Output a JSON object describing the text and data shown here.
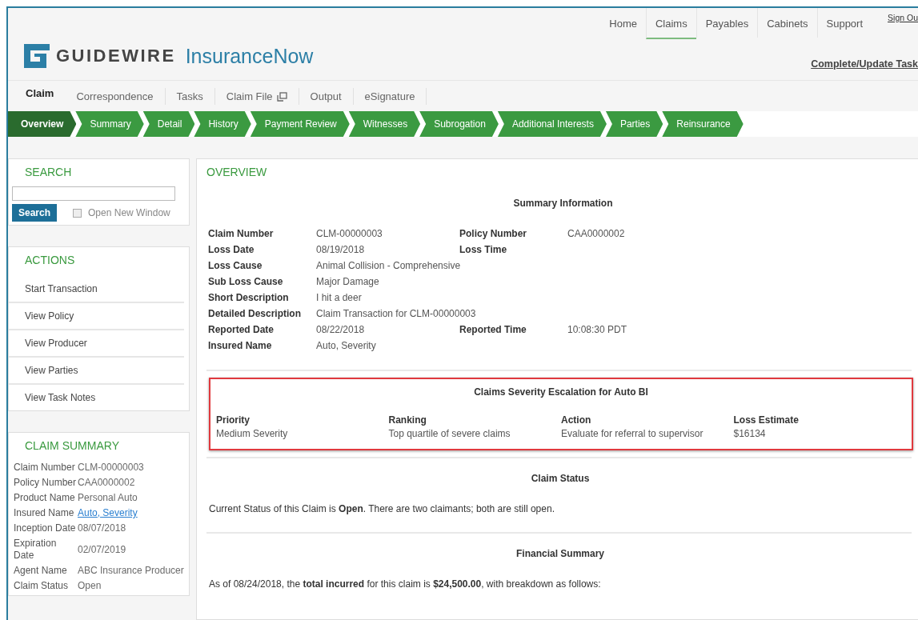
{
  "top_nav": [
    {
      "label": "Home",
      "selected": false
    },
    {
      "label": "Claims",
      "selected": true
    },
    {
      "label": "Payables",
      "selected": false
    },
    {
      "label": "Cabinets",
      "selected": false
    },
    {
      "label": "Support",
      "selected": false
    }
  ],
  "sign_out": "Sign Ou",
  "logo": {
    "brand": "GUIDEWIRE",
    "product": "InsuranceNow"
  },
  "task_link": "Complete/Update Task",
  "tabs": [
    {
      "label": "Claim",
      "selected": true,
      "kind": "plain"
    },
    {
      "label": "Correspondence",
      "selected": false,
      "kind": "plain"
    },
    {
      "label": "Tasks",
      "selected": false,
      "kind": "plain"
    },
    {
      "label": "Claim File",
      "selected": false,
      "kind": "popout"
    },
    {
      "label": "Output",
      "selected": false,
      "kind": "plain"
    },
    {
      "label": "eSignature",
      "selected": false,
      "kind": "plain"
    }
  ],
  "steps": [
    {
      "label": "Overview",
      "selected": true
    },
    {
      "label": "Summary",
      "selected": false
    },
    {
      "label": "Detail",
      "selected": false
    },
    {
      "label": "History",
      "selected": false
    },
    {
      "label": "Payment Review",
      "selected": false
    },
    {
      "label": "Witnesses",
      "selected": false
    },
    {
      "label": "Subrogation",
      "selected": false
    },
    {
      "label": "Additional Interests",
      "selected": false
    },
    {
      "label": "Parties",
      "selected": false
    },
    {
      "label": "Reinsurance",
      "selected": false
    }
  ],
  "search": {
    "title": "SEARCH",
    "button": "Search",
    "open_new_window": {
      "label": "Open New Window",
      "checked": false
    }
  },
  "actions": {
    "title": "ACTIONS",
    "items": [
      "Start Transaction",
      "View Policy",
      "View Producer",
      "View Parties",
      "View Task Notes"
    ]
  },
  "claim_summary": {
    "title": "CLAIM SUMMARY",
    "rows": [
      {
        "label": "Claim Number",
        "value": "CLM-00000003",
        "kind": "text"
      },
      {
        "label": "Policy Number",
        "value": "CAA0000002",
        "kind": "text"
      },
      {
        "label": "Product Name",
        "value": "Personal Auto",
        "kind": "text"
      },
      {
        "label": "Insured Name",
        "value": "Auto, Severity",
        "kind": "link"
      },
      {
        "label": "Inception Date",
        "value": "08/07/2018",
        "kind": "text"
      },
      {
        "label": "Expiration Date",
        "value": "02/07/2019",
        "kind": "text"
      },
      {
        "label": "Agent Name",
        "value": "ABC Insurance Producer",
        "kind": "text"
      },
      {
        "label": "Claim Status",
        "value": "Open",
        "kind": "text"
      }
    ]
  },
  "overview": {
    "title": "OVERVIEW",
    "summary": {
      "title": "Summary Information",
      "rows": [
        {
          "label": "Claim Number",
          "value": "CLM-00000003",
          "label_2": "Policy Number",
          "value_2": "CAA0000002"
        },
        {
          "label": "Loss Date",
          "value": "08/19/2018",
          "label_2": "Loss Time"
        },
        {
          "label": "Loss Cause",
          "value": "Animal Collision - Comprehensive"
        },
        {
          "label": "Sub Loss Cause",
          "value": "Major Damage"
        },
        {
          "label": "Short Description",
          "value": "I hit a deer"
        },
        {
          "label": "Detailed Description",
          "value": "Claim Transaction for CLM-00000003"
        },
        {
          "label": "Reported Date",
          "value": "08/22/2018",
          "label_2": "Reported Time",
          "value_2": "10:08:30 PDT"
        },
        {
          "label": "Insured Name",
          "value": "Auto, Severity"
        }
      ]
    },
    "escalation": {
      "title": "Claims Severity Escalation for Auto BI",
      "highlighted": true,
      "columns": [
        {
          "heading": "Priority",
          "value": "Medium Severity"
        },
        {
          "heading": "Ranking",
          "value": "Top quartile of severe claims"
        },
        {
          "heading": "Action",
          "value": "Evaluate for referral to supervisor"
        },
        {
          "heading": "Loss Estimate",
          "value": "$16134"
        }
      ]
    },
    "claim_status": {
      "title": "Claim Status",
      "text": "Current Status of this Claim is **Open**. There are two claimants; both are still open."
    },
    "financial_summary": {
      "title": "Financial Summary",
      "text": "As of 08/24/2018, the **total incurred** for this claim is **$24,500.00**, with breakdown as follows:"
    }
  }
}
